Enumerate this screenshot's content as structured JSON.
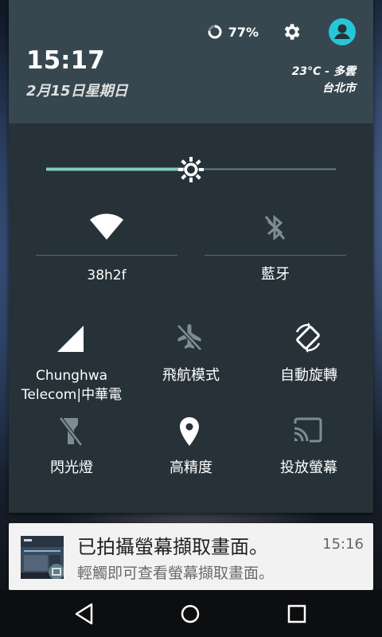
{
  "status": {
    "battery_text": "77%",
    "battery_level": 0.77,
    "battery_icon": "battery-ring-icon",
    "settings_icon": "gear-icon",
    "avatar_icon": "user-avatar-icon"
  },
  "header": {
    "time": "15:17",
    "date": "2月15日星期日",
    "weather_line1": "23°C - 多雲",
    "weather_line2": "台北市"
  },
  "brightness": {
    "level": 0.5,
    "icon": "brightness-icon"
  },
  "tiles_row1": [
    {
      "label": "38h2f",
      "icon": "wifi-icon",
      "active": true
    },
    {
      "label": "藍牙",
      "icon": "bluetooth-off-icon",
      "active": false
    }
  ],
  "tiles_row2": [
    {
      "label_line1": "Chunghwa",
      "label_line2": "Telecom|中華電",
      "icon": "cell-signal-icon"
    },
    {
      "label": "飛航模式",
      "icon": "airplane-off-icon"
    },
    {
      "label": "自動旋轉",
      "icon": "auto-rotate-icon"
    }
  ],
  "tiles_row3": [
    {
      "label": "閃光燈",
      "icon": "flashlight-off-icon"
    },
    {
      "label": "高精度",
      "icon": "location-icon"
    },
    {
      "label": "投放螢幕",
      "icon": "cast-icon"
    }
  ],
  "notification": {
    "title": "已拍攝螢幕擷取畫面。",
    "text": "輕觸即可查看螢幕擷取畫面。",
    "time": "15:16"
  },
  "navbar": {
    "back_icon": "back-icon",
    "home_icon": "home-icon",
    "recents_icon": "recents-icon"
  },
  "colors": {
    "accent": "#80cbc4",
    "avatar": "#26c6da",
    "shade_bg": "#263238",
    "header_bg": "#37474f"
  }
}
